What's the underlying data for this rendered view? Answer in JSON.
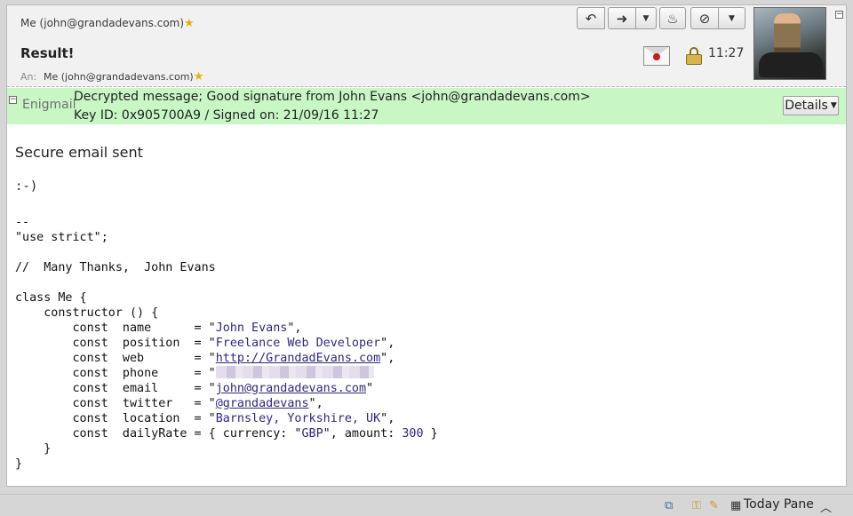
{
  "header": {
    "from": "Me (john@grandadevans.com)",
    "subject": "Result!",
    "to_label": "An:",
    "to": "Me (john@grandadevans.com)",
    "time": "11:27",
    "toolbar": [
      {
        "name": "reply-button",
        "icon": "↩"
      },
      {
        "name": "forward-button",
        "icon": "➔"
      },
      {
        "name": "forward-menu-button",
        "icon": "▼"
      },
      {
        "name": "flame-button",
        "icon": "🜂"
      },
      {
        "name": "junk-button",
        "icon": "⊘"
      },
      {
        "name": "more-menu-button",
        "icon": "▼"
      }
    ]
  },
  "enigmail": {
    "label": "Enigmail",
    "line1": "Decrypted message; Good signature from John Evans <john@grandadevans.com>",
    "line2": "Key ID: 0x905700A9 / Signed on: 21/09/16 11:27",
    "details_label": "Details",
    "color": "#c8f7c5"
  },
  "message": {
    "title": "Secure email sent",
    "smiley": ":-)",
    "separator": "--",
    "use_strict": "\"use strict\";",
    "comment": "//  Many Thanks,  John Evans",
    "class_open": "class Me {",
    "ctor_open": "    constructor () {",
    "fields": {
      "name": "John Evans",
      "position": "Freelance Web Developer",
      "web": "http://GrandadEvans.com",
      "email": "john@grandadevans.com",
      "twitter": "@grandadevans",
      "location": "Barnsley, Yorkshire, UK",
      "currency": "GBP",
      "amount": "300"
    },
    "ctor_close": "    }",
    "class_close": "}"
  },
  "statusbar": {
    "today_pane": "Today Pane"
  }
}
